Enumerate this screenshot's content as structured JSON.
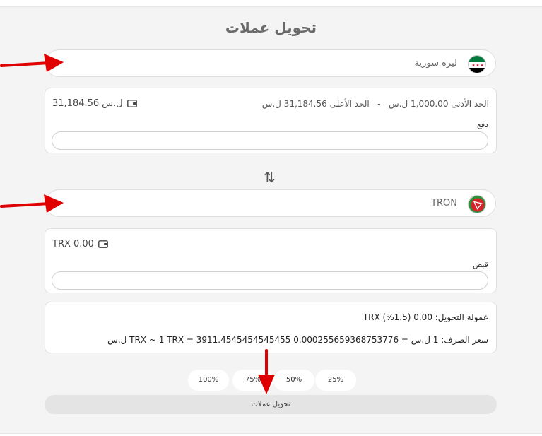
{
  "page": {
    "title": "تحويل عملات"
  },
  "from_currency": {
    "name": "ليرة سورية"
  },
  "from_box": {
    "min_label": "الحد الأدنى",
    "min_value": "1,000.00 ل.س",
    "separator": "-",
    "max_label": "الحد الأعلى",
    "max_value": "31,184.56 ل.س",
    "balance": "31,184.56 ل.س",
    "field_label": "دفع",
    "field_value": ""
  },
  "swap_icon": "⇅",
  "to_currency": {
    "name": "TRON"
  },
  "to_box": {
    "balance": "TRX 0.00",
    "field_label": "قبض",
    "field_value": ""
  },
  "info": {
    "commission": "عمولة التحويل: 0.00 TRX (%1.5)",
    "rate": "سعر الصرف: 1 ل.س = 0.000255659368753776 TRX ~ 1 TRX = 3911.4545454545455 ل.س"
  },
  "percent_buttons": [
    "100%",
    "75%",
    "50%",
    "25%"
  ],
  "submit_label": "تحويل عملات",
  "colors": {
    "panel": "#f4f4f4",
    "arrow": "#e00000",
    "tron_red": "#d8232a",
    "flag_green": "#007a3d"
  }
}
